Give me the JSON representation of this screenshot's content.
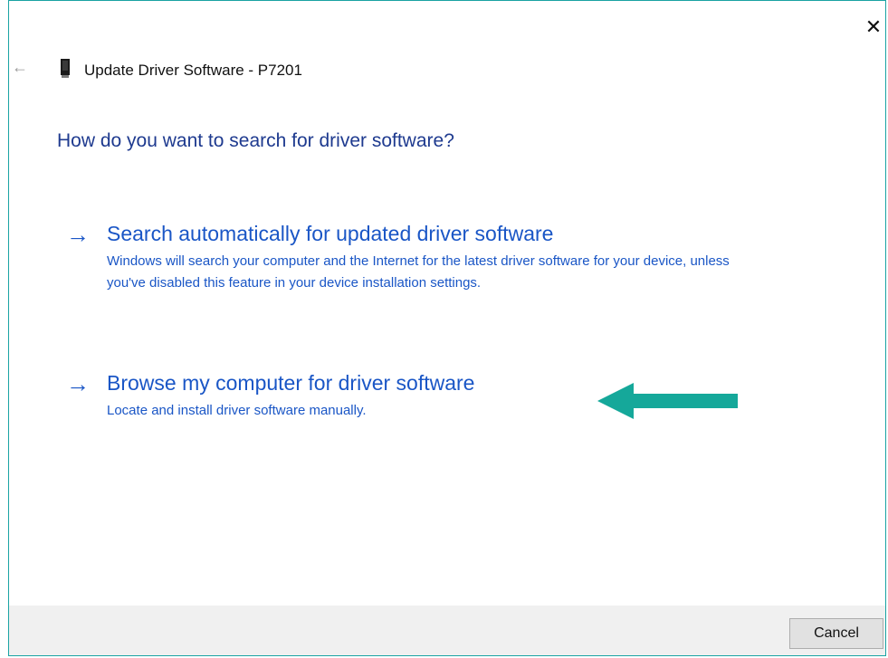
{
  "window": {
    "title": "Update Driver Software - P7201",
    "close_glyph": "✕",
    "back_glyph": "←"
  },
  "heading": "How do you want to search for driver software?",
  "options": [
    {
      "title": "Search automatically for updated driver software",
      "description": "Windows will search your computer and the Internet for the latest driver software for your device, unless you've disabled this feature in your device installation settings.",
      "arrow_glyph": "→"
    },
    {
      "title": "Browse my computer for driver software",
      "description": "Locate and install driver software manually.",
      "arrow_glyph": "→"
    }
  ],
  "footer": {
    "cancel_label": "Cancel"
  },
  "colors": {
    "link_blue": "#1a56c6",
    "heading_blue": "#1e3a8f",
    "annotation_teal": "#15a89a",
    "window_border": "#1aa3a3"
  },
  "icons": {
    "device": "device-icon",
    "back": "back-arrow-icon",
    "close": "close-icon",
    "annotation": "annotation-arrow-icon"
  }
}
